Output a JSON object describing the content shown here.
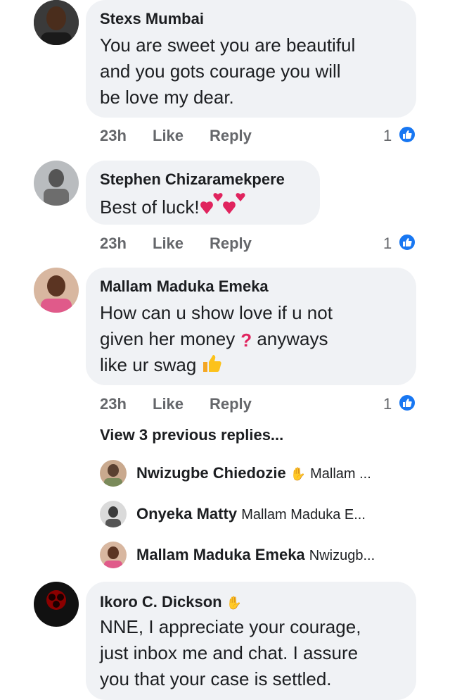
{
  "comments": [
    {
      "name": "Stexs Mumbai",
      "lines": [
        "You are sweet you are beautiful",
        "and you gots courage you will",
        "be love my dear."
      ],
      "time": "23h",
      "like": "Like",
      "reply": "Reply",
      "count": "1"
    },
    {
      "name": "Stephen Chizaramekpere",
      "text": "Best of luck!",
      "time": "23h",
      "like": "Like",
      "reply": "Reply",
      "count": "1"
    },
    {
      "name": "Mallam Maduka Emeka",
      "line1": "How can u show love if u not",
      "line2a": "given her money",
      "line2b": " anyways",
      "line3": "like ur swag ",
      "time": "23h",
      "like": "Like",
      "reply": "Reply",
      "count": "1"
    },
    {
      "name": "Ikoro C. Dickson",
      "lines": [
        "NNE, I appreciate your courage,",
        "just inbox me and chat. I assure",
        "you that your case is settled."
      ]
    }
  ],
  "view_previous": "View 3 previous replies...",
  "replies": [
    {
      "name": "Nwizugbe Chiedozie",
      "text": "Mallam ..."
    },
    {
      "name": "Onyeka Matty",
      "text": "Mallam Maduka E..."
    },
    {
      "name": "Mallam Maduka Emeka",
      "text": "Nwizugb..."
    }
  ],
  "colors": {
    "bubble": "#f0f2f5",
    "meta": "#65676b",
    "like_blue": "#1877f2"
  },
  "icons": {
    "like_badge": "thumbs-up-icon",
    "hearts": "two-hearts-emoji",
    "question": "red-question-emoji",
    "thumbs": "thumbs-up-emoji",
    "wave": "waving-hand-icon"
  }
}
